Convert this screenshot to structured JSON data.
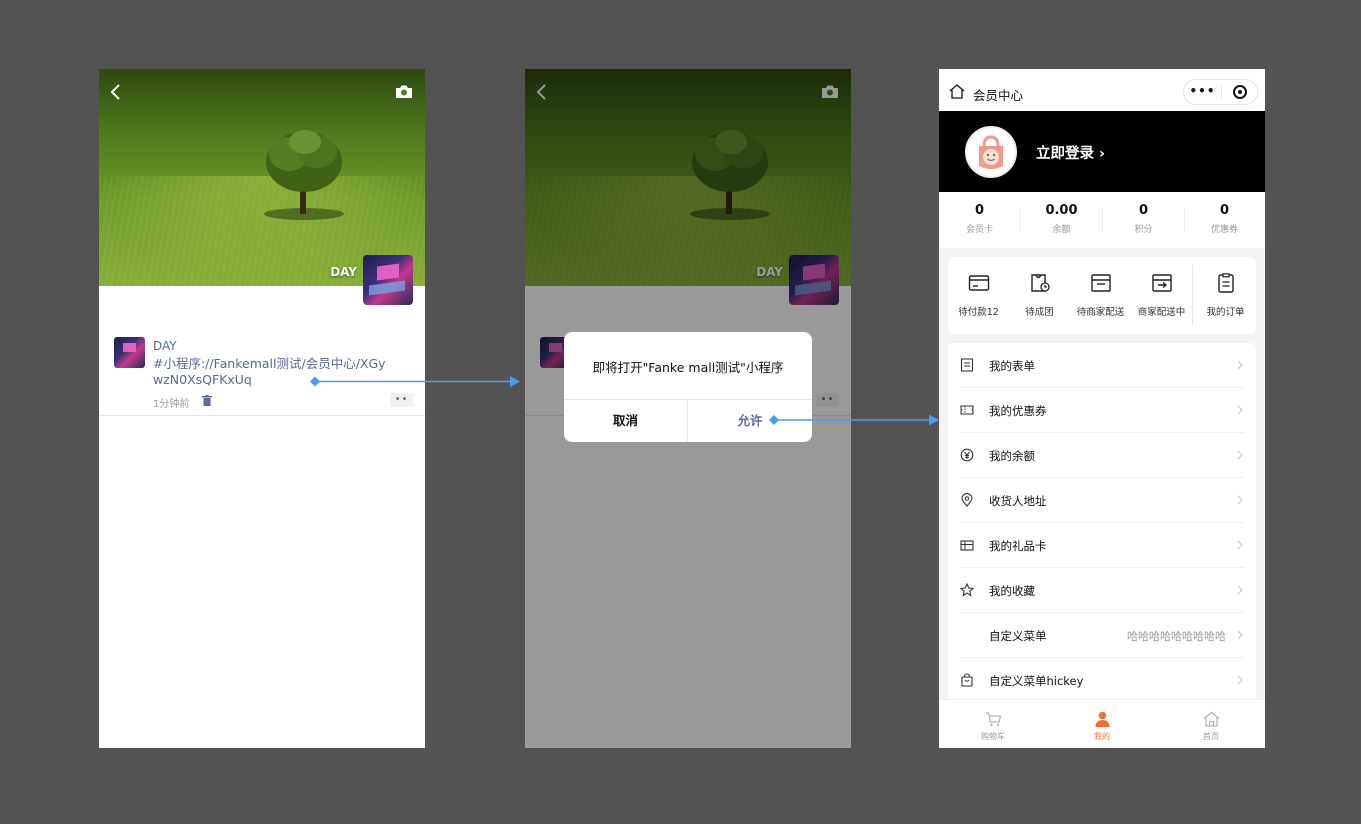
{
  "phone1": {
    "cover_name": "DAY",
    "post": {
      "author": "DAY",
      "link_text": "#小程序://Fankemall测试/会员中心/XGywzN0XsQFKxUq",
      "time": "1分钟前",
      "more": "••"
    }
  },
  "phone2": {
    "cover_name": "DAY",
    "more": "••",
    "dialog": {
      "message": "即将打开\"Fanke mall测试\"小程序",
      "cancel_label": "取消",
      "allow_label": "允许"
    }
  },
  "phone3": {
    "nav": {
      "title": "会员中心",
      "more": "•••"
    },
    "login_label": "立即登录 ›",
    "stats": [
      {
        "value": "0",
        "label": "会员卡"
      },
      {
        "value": "0.00",
        "label": "余额"
      },
      {
        "value": "0",
        "label": "积分"
      },
      {
        "value": "0",
        "label": "优惠券"
      }
    ],
    "orders": [
      {
        "label": "待付款12",
        "icon": "wallet-icon"
      },
      {
        "label": "待成团",
        "icon": "group-bag-icon"
      },
      {
        "label": "待商家配送",
        "icon": "box-icon"
      },
      {
        "label": "商家配送中",
        "icon": "delivery-icon"
      },
      {
        "label": "我的订单",
        "icon": "clipboard-icon"
      }
    ],
    "menu": [
      {
        "label": "我的表单",
        "value": "",
        "icon": "form-icon"
      },
      {
        "label": "我的优惠券",
        "value": "",
        "icon": "coupon-icon"
      },
      {
        "label": "我的余额",
        "value": "",
        "icon": "balance-icon"
      },
      {
        "label": "收货人地址",
        "value": "",
        "icon": "location-icon"
      },
      {
        "label": "我的礼品卡",
        "value": "",
        "icon": "gift-card-icon"
      },
      {
        "label": "我的收藏",
        "value": "",
        "icon": "star-icon"
      },
      {
        "label": "自定义菜单",
        "value": "哈哈哈哈哈哈哈哈哈",
        "icon": ""
      },
      {
        "label": "自定义菜单hickey",
        "value": "",
        "icon": "bag-icon"
      }
    ],
    "tabs": [
      {
        "label": "购物车",
        "icon": "cart-icon",
        "active": false
      },
      {
        "label": "我的",
        "icon": "person-icon",
        "active": true
      },
      {
        "label": "首页",
        "icon": "home-icon",
        "active": false
      }
    ],
    "colors": {
      "active": "#f0722c",
      "header": "#000000",
      "link": "#576b95"
    }
  }
}
